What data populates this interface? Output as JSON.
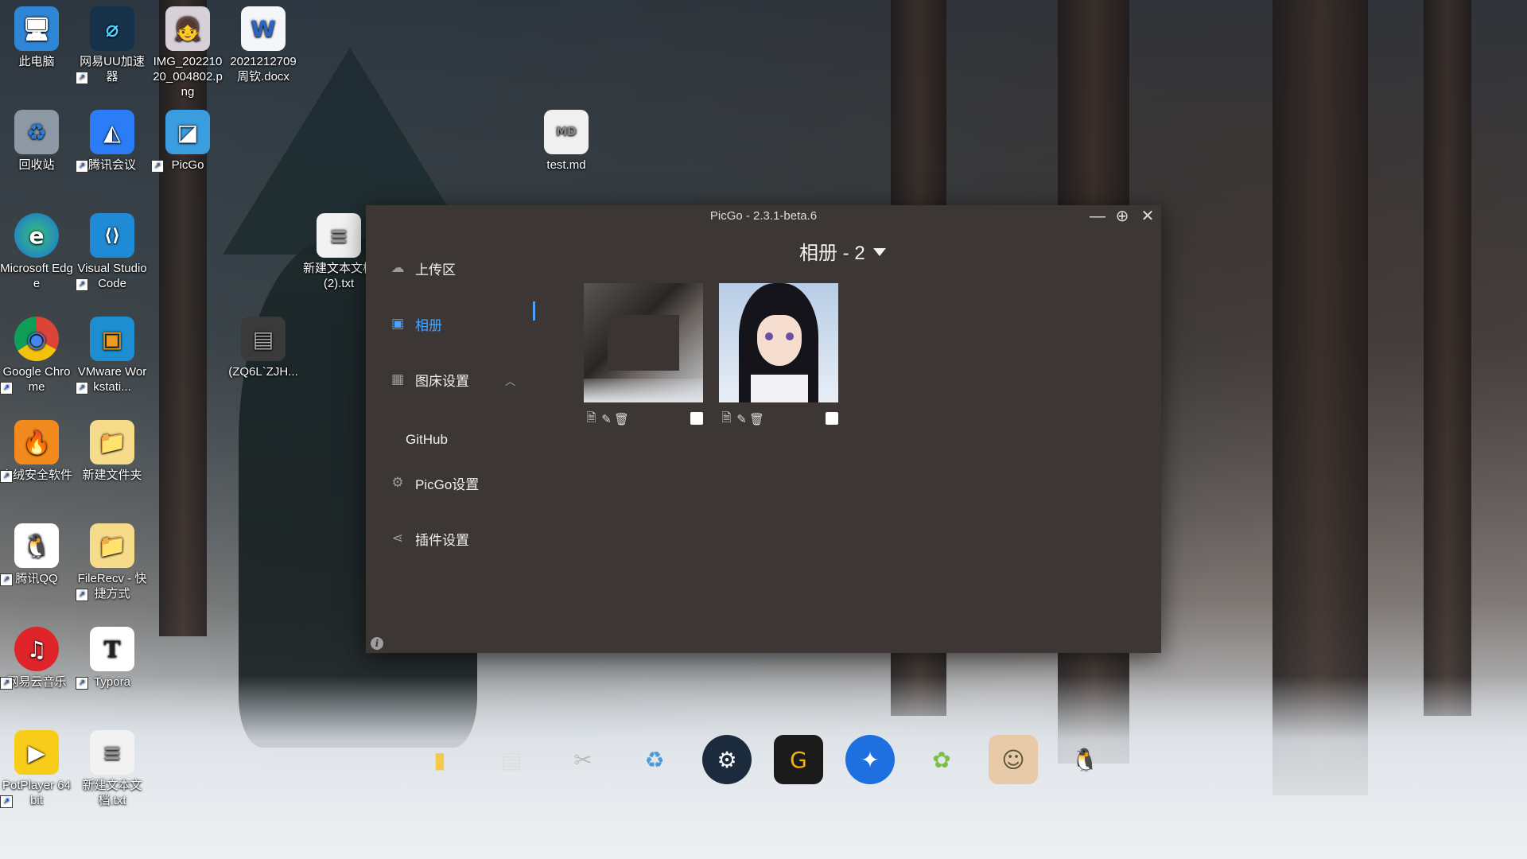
{
  "desktop": {
    "icons": [
      {
        "label": "此电脑",
        "glyph": "🖥"
      },
      {
        "label": "网易UU加速器",
        "glyph": "⌀"
      },
      {
        "label": "IMG_20221020_004802.png",
        "glyph": "👧"
      },
      {
        "label": "2021212709周钦.docx",
        "glyph": "W"
      },
      {
        "label": "回收站",
        "glyph": "♻"
      },
      {
        "label": "腾讯会议",
        "glyph": "◭"
      },
      {
        "label": "PicGo",
        "glyph": "◪"
      },
      {
        "label": "test.md",
        "glyph": "MD"
      },
      {
        "label": "Microsoft Edge",
        "glyph": "e"
      },
      {
        "label": "Visual Studio Code",
        "glyph": "⟨⟩"
      },
      {
        "label": "新建文本文档(2).txt",
        "glyph": "≡"
      },
      {
        "label": "Google Chrome",
        "glyph": "◉"
      },
      {
        "label": "VMware Workstati...",
        "glyph": "▣"
      },
      {
        "label": "(ZQ6L`ZJH...",
        "glyph": "▤"
      },
      {
        "label": "火绒安全软件",
        "glyph": "🔥"
      },
      {
        "label": "新建文件夹",
        "glyph": "📁"
      },
      {
        "label": "腾讯QQ",
        "glyph": "🐧"
      },
      {
        "label": "FileRecv - 快捷方式",
        "glyph": "📁"
      },
      {
        "label": "网易云音乐",
        "glyph": "♫"
      },
      {
        "label": "Typora",
        "glyph": "T"
      },
      {
        "label": "PotPlayer 64 bit",
        "glyph": "▶"
      },
      {
        "label": "新建文本文档.txt",
        "glyph": "≡"
      }
    ],
    "dock": [
      "folder",
      "notepad",
      "tools",
      "recycle",
      "steam",
      "game-g",
      "browser-e",
      "plant",
      "genshin",
      "qq"
    ]
  },
  "picgo": {
    "title": "PicGo - 2.3.1-beta.6",
    "controls": {
      "minimize": "—",
      "pin": "⊕",
      "close": "✕"
    },
    "nav": {
      "upload": "上传区",
      "album": "相册",
      "bed_settings": "图床设置",
      "github": "GitHub",
      "picgo_settings": "PicGo设置",
      "plugin_settings": "插件设置"
    },
    "album_header": "相册 - 2",
    "images": [
      {
        "name": "screenshot-thumb",
        "checked": false
      },
      {
        "name": "anime-girl-thumb",
        "checked": false
      }
    ],
    "accent": "#4aa3ff",
    "bg": "#3c3734"
  }
}
